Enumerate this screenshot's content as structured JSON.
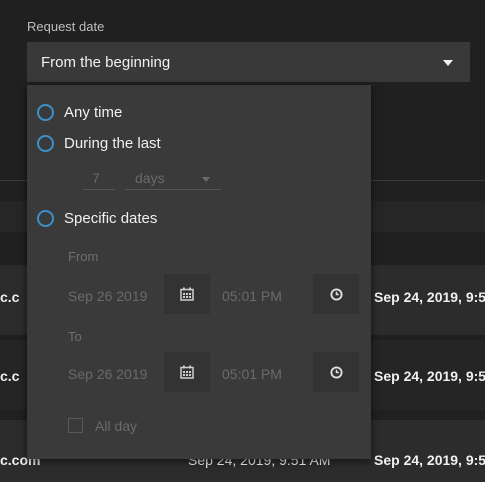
{
  "filter": {
    "label": "Request date",
    "selected": "From the beginning"
  },
  "dropdown": {
    "options": {
      "any_time": "Any time",
      "during_last": "During the last",
      "specific_dates": "Specific dates"
    },
    "during_last": {
      "amount": "7",
      "unit": "days"
    },
    "from": {
      "label": "From",
      "date": "Sep 26 2019",
      "time": "05:01 PM"
    },
    "to": {
      "label": "To",
      "date": "Sep 26 2019",
      "time": "05:01 PM"
    },
    "all_day_label": "All day"
  },
  "background_rows": [
    {
      "left_cell": "c.c",
      "right_cell": "Sep 24, 2019, 9:5"
    },
    {
      "left_cell": "c.c",
      "right_cell": "Sep 24, 2019, 9:5"
    },
    {
      "left_cell": "c.com",
      "middle_cell": "Sep 24, 2019, 9:51 AM",
      "right_cell": "Sep 24, 2019, 9:5"
    }
  ],
  "colors": {
    "accent": "#3d8fc9",
    "panel": "#3a3a3a",
    "background": "#202020"
  }
}
